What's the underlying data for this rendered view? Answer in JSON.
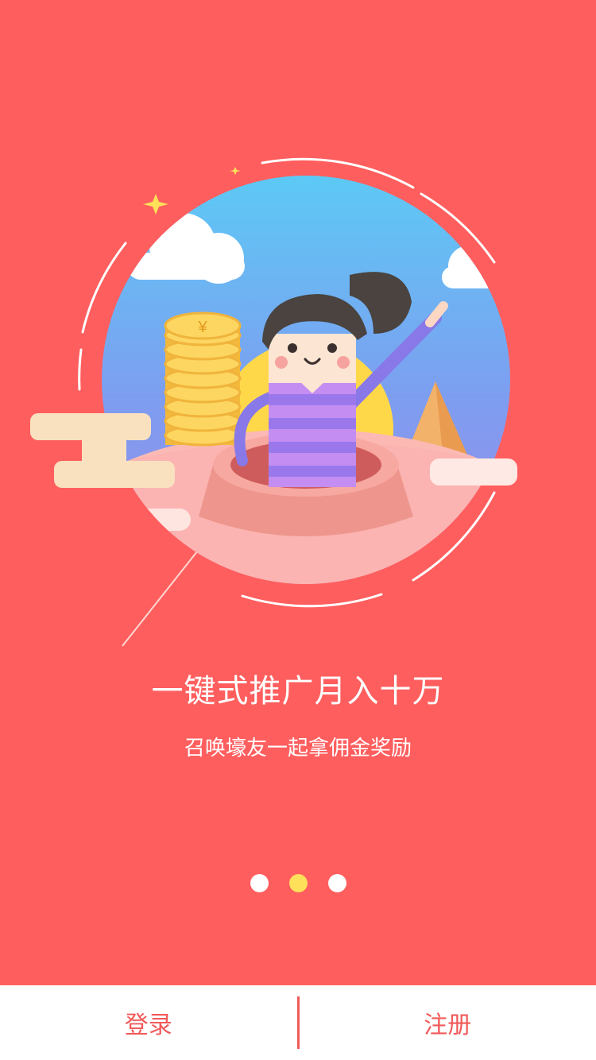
{
  "slide": {
    "headline": "一键式推广月入十万",
    "subline": "召唤壕友一起拿佣金奖励",
    "illustration_coin_symbol": "¥"
  },
  "pager": {
    "total": 3,
    "active_index": 2
  },
  "bottom_bar": {
    "login_label": "登录",
    "register_label": "注册"
  },
  "colors": {
    "background": "#ff5e5e",
    "accent_dot": "#ffe05a",
    "button_text": "#f25a5a"
  }
}
